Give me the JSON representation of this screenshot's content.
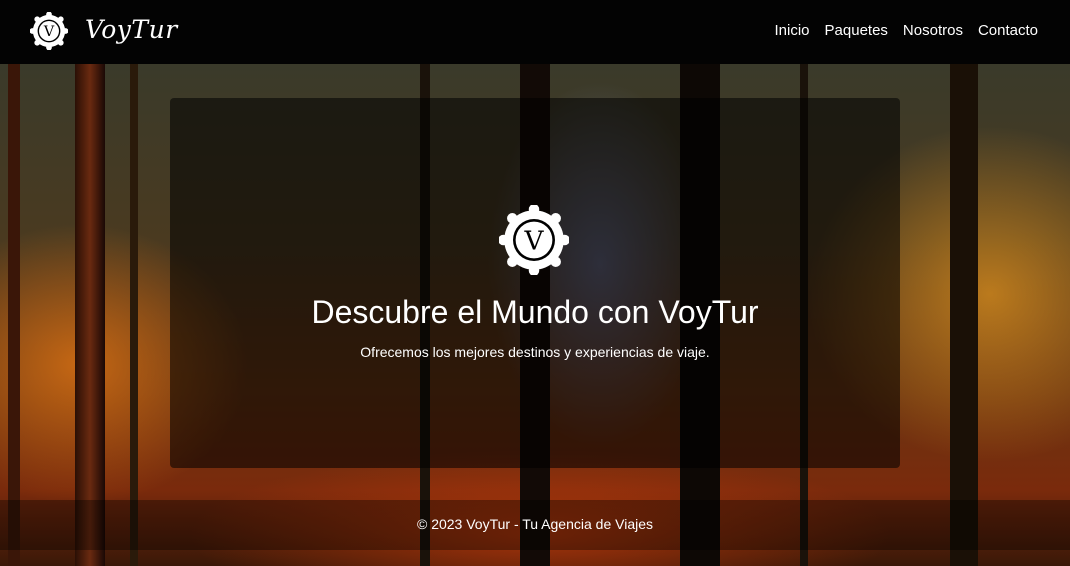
{
  "header": {
    "brand": "VoyTur",
    "logo_letter": "V",
    "nav": [
      {
        "label": "Inicio"
      },
      {
        "label": "Paquetes"
      },
      {
        "label": "Nosotros"
      },
      {
        "label": "Contacto"
      }
    ]
  },
  "hero": {
    "logo_letter": "V",
    "title": "Descubre el Mundo con VoyTur",
    "subtitle": "Ofrecemos los mejores destinos y experiencias de viaje."
  },
  "footer": {
    "text": "© 2023 VoyTur - Tu Agencia de Viajes"
  },
  "colors": {
    "header_bg": "#030303",
    "text": "#ffffff"
  },
  "icons": {
    "logo": "ornamental-badge-icon"
  }
}
